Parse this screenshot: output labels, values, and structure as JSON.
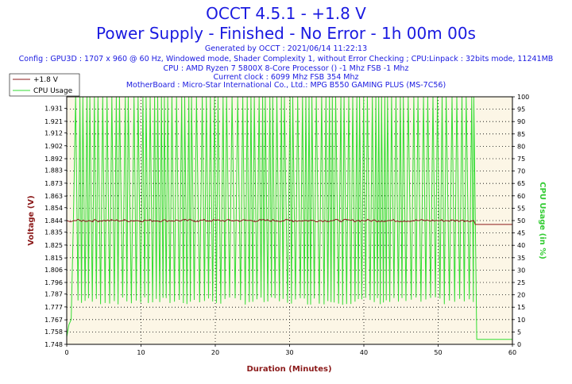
{
  "header": {
    "title_line1": "OCCT 4.5.1 - +1.8 V",
    "title_line2": "Power Supply - Finished - No Error - 1h 00m 00s",
    "info_lines": [
      "Generated by OCCT : 2021/06/14 11:22:13",
      "Config : GPU3D : 1707 x 960 @ 60 Hz, Windowed mode, Shader Complexity 1, without Error Checking ; CPU:Linpack : 32bits mode, 11241MB",
      "CPU : AMD Ryzen 7 5800X 8-Core Processor () -1 Mhz FSB -1 Mhz",
      "Current clock : 6099 Mhz FSB 354 Mhz",
      "MotherBoard : Micro-Star International Co., Ltd.: MPG B550 GAMING PLUS (MS-7C56)"
    ]
  },
  "colors": {
    "header": "#1a1ae0",
    "voltage": "#8b1a1a",
    "cpu": "#33dd33",
    "plot_bg": "#fcf6e6",
    "axis_right_label": "#33cc33"
  },
  "chart_data": {
    "type": "line",
    "xlabel": "Duration (Minutes)",
    "ylabel_left": "Voltage (V)",
    "ylabel_right": "CPU Usage (in %)",
    "xlim": [
      0,
      60
    ],
    "ylim_left": [
      1.748,
      1.94
    ],
    "ylim_right": [
      0,
      100
    ],
    "x_ticks": [
      "0",
      "10",
      "20",
      "30",
      "40",
      "50",
      "60"
    ],
    "y_left_ticks": [
      "1.748",
      "1.758",
      "1.767",
      "1.777",
      "1.787",
      "1.796",
      "1.806",
      "1.815",
      "1.825",
      "1.835",
      "1.844",
      "1.854",
      "1.863",
      "1.873",
      "1.883",
      "1.892",
      "1.902",
      "1.912",
      "1.921",
      "1.931"
    ],
    "y_right_ticks": [
      "0",
      "5",
      "10",
      "15",
      "20",
      "25",
      "30",
      "35",
      "40",
      "45",
      "50",
      "55",
      "60",
      "65",
      "70",
      "75",
      "80",
      "85",
      "90",
      "95",
      "100"
    ],
    "grid": true,
    "legend_position": "top-left",
    "series": [
      {
        "name": "+1.8 V",
        "axis": "left",
        "x": [
          0,
          0.5,
          1,
          5,
          10,
          15,
          20,
          25,
          30,
          35,
          40,
          45,
          50,
          54.8,
          55,
          56,
          60
        ],
        "y": [
          1.844,
          1.843,
          1.844,
          1.844,
          1.844,
          1.844,
          1.844,
          1.844,
          1.844,
          1.844,
          1.844,
          1.844,
          1.844,
          1.844,
          1.841,
          1.841,
          1.841
        ],
        "noise": 0.002
      },
      {
        "name": "CPU Usage",
        "axis": "right",
        "x": [
          0,
          0.3,
          0.6,
          0.9,
          1.2,
          54.8,
          55.2,
          60
        ],
        "y": [
          3,
          8,
          10,
          50,
          100,
          100,
          2,
          2
        ],
        "oscillation": {
          "x_start": 1.2,
          "x_end": 54.8,
          "high": 100,
          "low": 16
        }
      }
    ]
  }
}
